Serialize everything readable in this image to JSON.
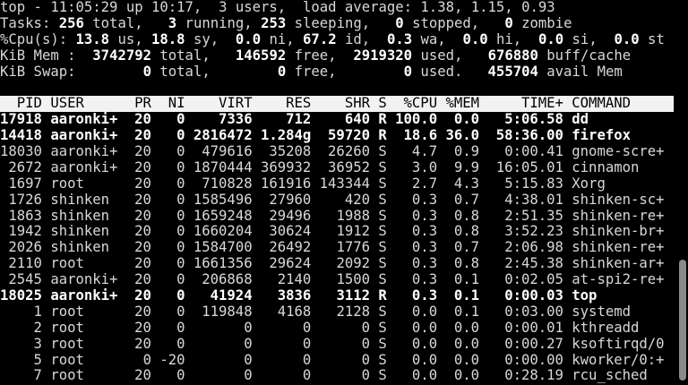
{
  "summary": [
    [
      {
        "t": "top - 11:05:29 up 10:17,  3 users,  load average: 1.38, 1.15, 0.93",
        "b": false
      }
    ],
    [
      {
        "t": "Tasks: ",
        "b": false
      },
      {
        "t": "256",
        "b": true
      },
      {
        "t": " total,   ",
        "b": false
      },
      {
        "t": "3",
        "b": true
      },
      {
        "t": " running, ",
        "b": false
      },
      {
        "t": "253",
        "b": true
      },
      {
        "t": " sleeping,   ",
        "b": false
      },
      {
        "t": "0",
        "b": true
      },
      {
        "t": " stopped,   ",
        "b": false
      },
      {
        "t": "0",
        "b": true
      },
      {
        "t": " zombie",
        "b": false
      }
    ],
    [
      {
        "t": "%Cpu(s): ",
        "b": false
      },
      {
        "t": "13.8",
        "b": true
      },
      {
        "t": " us, ",
        "b": false
      },
      {
        "t": "18.8",
        "b": true
      },
      {
        "t": " sy,  ",
        "b": false
      },
      {
        "t": "0.0",
        "b": true
      },
      {
        "t": " ni, ",
        "b": false
      },
      {
        "t": "67.2",
        "b": true
      },
      {
        "t": " id,  ",
        "b": false
      },
      {
        "t": "0.3",
        "b": true
      },
      {
        "t": " wa,  ",
        "b": false
      },
      {
        "t": "0.0",
        "b": true
      },
      {
        "t": " hi,  ",
        "b": false
      },
      {
        "t": "0.0",
        "b": true
      },
      {
        "t": " si,  ",
        "b": false
      },
      {
        "t": "0.0",
        "b": true
      },
      {
        "t": " st",
        "b": false
      }
    ],
    [
      {
        "t": "KiB Mem :  ",
        "b": false
      },
      {
        "t": "3742792",
        "b": true
      },
      {
        "t": " total,   ",
        "b": false
      },
      {
        "t": "146592",
        "b": true
      },
      {
        "t": " free,  ",
        "b": false
      },
      {
        "t": "2919320",
        "b": true
      },
      {
        "t": " used,   ",
        "b": false
      },
      {
        "t": "676880",
        "b": true
      },
      {
        "t": " buff/cache",
        "b": false
      }
    ],
    [
      {
        "t": "KiB Swap:        ",
        "b": false
      },
      {
        "t": "0",
        "b": true
      },
      {
        "t": " total,        ",
        "b": false
      },
      {
        "t": "0",
        "b": true
      },
      {
        "t": " free,        ",
        "b": false
      },
      {
        "t": "0",
        "b": true
      },
      {
        "t": " used.   ",
        "b": false
      },
      {
        "t": "455704",
        "b": true
      },
      {
        "t": " avail Mem",
        "b": false
      }
    ]
  ],
  "columns": [
    "PID",
    "USER",
    "PR",
    "NI",
    "VIRT",
    "RES",
    "SHR",
    "S",
    "%CPU",
    "%MEM",
    "TIME+",
    "COMMAND"
  ],
  "processes": [
    {
      "bold": true,
      "cells": [
        "17918",
        "aaronki+",
        "20",
        "0",
        "7336",
        "712",
        "640",
        "R",
        "100.0",
        "0.0",
        "5:06.58",
        "dd"
      ]
    },
    {
      "bold": true,
      "cells": [
        "14418",
        "aaronki+",
        "20",
        "0",
        "2816472",
        "1.284g",
        "59720",
        "R",
        "18.6",
        "36.0",
        "58:36.00",
        "firefox"
      ]
    },
    {
      "bold": false,
      "cells": [
        "18030",
        "aaronki+",
        "20",
        "0",
        "479616",
        "35208",
        "26260",
        "S",
        "4.7",
        "0.9",
        "0:00.41",
        "gnome-scre+"
      ]
    },
    {
      "bold": false,
      "cells": [
        "2672",
        "aaronki+",
        "20",
        "0",
        "1870444",
        "369932",
        "36952",
        "S",
        "3.0",
        "9.9",
        "16:05.01",
        "cinnamon"
      ]
    },
    {
      "bold": false,
      "cells": [
        "1697",
        "root",
        "20",
        "0",
        "710828",
        "161916",
        "143344",
        "S",
        "2.7",
        "4.3",
        "5:15.83",
        "Xorg"
      ]
    },
    {
      "bold": false,
      "cells": [
        "1726",
        "shinken",
        "20",
        "0",
        "1585496",
        "27960",
        "420",
        "S",
        "0.3",
        "0.7",
        "4:38.01",
        "shinken-sc+"
      ]
    },
    {
      "bold": false,
      "cells": [
        "1863",
        "shinken",
        "20",
        "0",
        "1659248",
        "29496",
        "1988",
        "S",
        "0.3",
        "0.8",
        "2:51.35",
        "shinken-re+"
      ]
    },
    {
      "bold": false,
      "cells": [
        "1942",
        "shinken",
        "20",
        "0",
        "1660204",
        "30624",
        "1912",
        "S",
        "0.3",
        "0.8",
        "3:52.23",
        "shinken-br+"
      ]
    },
    {
      "bold": false,
      "cells": [
        "2026",
        "shinken",
        "20",
        "0",
        "1584700",
        "26492",
        "1776",
        "S",
        "0.3",
        "0.7",
        "2:06.98",
        "shinken-re+"
      ]
    },
    {
      "bold": false,
      "cells": [
        "2110",
        "root",
        "20",
        "0",
        "1661356",
        "29624",
        "2092",
        "S",
        "0.3",
        "0.8",
        "2:45.38",
        "shinken-ar+"
      ]
    },
    {
      "bold": false,
      "cells": [
        "2545",
        "aaronki+",
        "20",
        "0",
        "206868",
        "2140",
        "1500",
        "S",
        "0.3",
        "0.1",
        "0:02.05",
        "at-spi2-re+"
      ]
    },
    {
      "bold": true,
      "cells": [
        "18025",
        "aaronki+",
        "20",
        "0",
        "41924",
        "3836",
        "3112",
        "R",
        "0.3",
        "0.1",
        "0:00.03",
        "top"
      ]
    },
    {
      "bold": false,
      "cells": [
        "1",
        "root",
        "20",
        "0",
        "119848",
        "4168",
        "2128",
        "S",
        "0.0",
        "0.1",
        "0:03.00",
        "systemd"
      ]
    },
    {
      "bold": false,
      "cells": [
        "2",
        "root",
        "20",
        "0",
        "0",
        "0",
        "0",
        "S",
        "0.0",
        "0.0",
        "0:00.01",
        "kthreadd"
      ]
    },
    {
      "bold": false,
      "cells": [
        "3",
        "root",
        "20",
        "0",
        "0",
        "0",
        "0",
        "S",
        "0.0",
        "0.0",
        "0:00.27",
        "ksoftirqd/0"
      ]
    },
    {
      "bold": false,
      "cells": [
        "5",
        "root",
        "0",
        "-20",
        "0",
        "0",
        "0",
        "S",
        "0.0",
        "0.0",
        "0:00.00",
        "kworker/0:+"
      ]
    },
    {
      "bold": false,
      "cells": [
        "7",
        "root",
        "20",
        "0",
        "0",
        "0",
        "0",
        "S",
        "0.0",
        "0.0",
        "0:28.19",
        "rcu_sched"
      ]
    }
  ]
}
